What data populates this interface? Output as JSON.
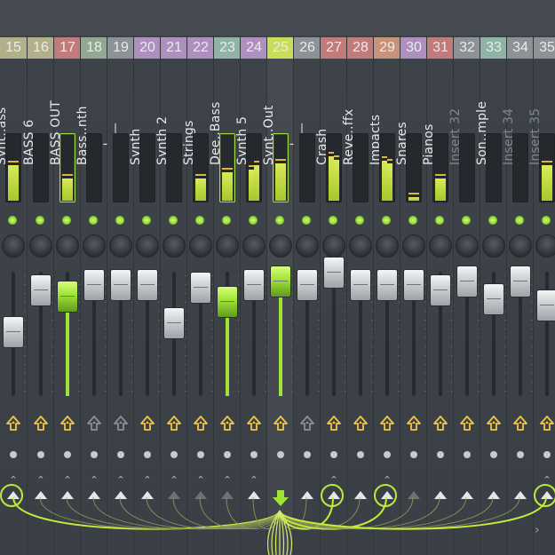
{
  "window": {
    "title": ""
  },
  "colors": {
    "accent": "#9ee336",
    "meter": "#c9e23f",
    "peak": "#e3b43a",
    "route_icon": "#f2c64a",
    "route_icon_dim": "#8a9095"
  },
  "icons": {
    "route": "route-arrow-icon",
    "send_up": "triangle-up-icon",
    "current_insert": "arrow-down-icon",
    "scroll": "chevron-right-icon"
  },
  "strips": [
    {
      "num": "15",
      "name": "Synt..ass",
      "num_bg": "#b1b08b",
      "level": 0.52,
      "meter_l": 0.55,
      "meter_r": 0.55,
      "route": "yellow",
      "caret": true,
      "send": "ring",
      "name_dim": false,
      "highlight": false
    },
    {
      "num": "16",
      "name": "BASS 6",
      "num_bg": "#b1b08b",
      "level": 0.8,
      "meter_l": 0,
      "meter_r": 0,
      "route": "yellow",
      "caret": true,
      "send": "tri",
      "name_dim": false,
      "highlight": false
    },
    {
      "num": "17",
      "name": "BASS OUT",
      "num_bg": "#c27b7b",
      "level": 0.76,
      "meter_l": 0.35,
      "meter_r": 0.35,
      "route": "yellow",
      "caret": true,
      "send": "tri",
      "name_dim": false,
      "highlight": true
    },
    {
      "num": "18",
      "name": "Bass..nth",
      "num_bg": "#93a890",
      "level": 0.84,
      "meter_l": 0,
      "meter_r": 0,
      "route": "gray",
      "caret": true,
      "send": "tri",
      "name_dim": false,
      "highlight": false
    },
    {
      "num": "19",
      "name": "___'___",
      "num_bg": "#8d9297",
      "level": 0.84,
      "meter_l": 0,
      "meter_r": 0,
      "route": "gray",
      "caret": true,
      "send": "tri",
      "name_dim": false,
      "highlight": false
    },
    {
      "num": "20",
      "name": "Synth",
      "num_bg": "#ae90bf",
      "level": 0.84,
      "meter_l": 0,
      "meter_r": 0,
      "route": "yellow",
      "caret": true,
      "send": "tri",
      "name_dim": false,
      "highlight": false
    },
    {
      "num": "21",
      "name": "Synth 2",
      "num_bg": "#ae90bf",
      "level": 0.58,
      "meter_l": 0,
      "meter_r": 0,
      "route": "yellow",
      "caret": true,
      "send": "hollow",
      "name_dim": false,
      "highlight": false
    },
    {
      "num": "22",
      "name": "Strings",
      "num_bg": "#ae90bf",
      "level": 0.82,
      "meter_l": 0.35,
      "meter_r": 0.35,
      "route": "yellow",
      "caret": true,
      "send": "hollow",
      "name_dim": false,
      "highlight": false
    },
    {
      "num": "23",
      "name": "Dee..Bass",
      "num_bg": "#8fb3a4",
      "level": 0.72,
      "meter_l": 0.45,
      "meter_r": 0.45,
      "route": "yellow",
      "caret": true,
      "send": "hollow",
      "name_dim": false,
      "highlight": true
    },
    {
      "num": "24",
      "name": "Synth 5",
      "num_bg": "#ae90bf",
      "level": 0.84,
      "meter_l": 0.48,
      "meter_r": 0.55,
      "route": "yellow",
      "caret": true,
      "send": "tri",
      "name_dim": false,
      "highlight": false
    },
    {
      "num": "25",
      "name": "Synt..Out",
      "num_bg": "#c9dd5b",
      "level": 0.86,
      "meter_l": 0.58,
      "meter_r": 0.58,
      "route": "yellow",
      "caret": false,
      "send": "down",
      "name_dim": false,
      "highlight": true
    },
    {
      "num": "26",
      "name": "___'___",
      "num_bg": "#8d9297",
      "level": 0.84,
      "meter_l": 0,
      "meter_r": 0,
      "route": "gray",
      "caret": false,
      "send": "tri",
      "name_dim": false,
      "highlight": false
    },
    {
      "num": "27",
      "name": "Crash",
      "num_bg": "#c27b7b",
      "level": 0.92,
      "meter_l": 0.7,
      "meter_r": 0.64,
      "route": "yellow",
      "caret": true,
      "send": "ring",
      "name_dim": false,
      "highlight": false
    },
    {
      "num": "28",
      "name": "Reve..ffx",
      "num_bg": "#c27b7b",
      "level": 0.84,
      "meter_l": 0,
      "meter_r": 0,
      "route": "yellow",
      "caret": false,
      "send": "tri",
      "name_dim": false,
      "highlight": false
    },
    {
      "num": "29",
      "name": "Impacts",
      "num_bg": "#c7937b",
      "level": 0.84,
      "meter_l": 0.62,
      "meter_r": 0.58,
      "route": "yellow",
      "caret": true,
      "send": "ring",
      "name_dim": false,
      "highlight": false
    },
    {
      "num": "30",
      "name": "Snares",
      "num_bg": "#ae90bf",
      "level": 0.84,
      "meter_l": 0.05,
      "meter_r": 0.05,
      "route": "yellow",
      "caret": false,
      "send": "hollow",
      "name_dim": false,
      "highlight": false
    },
    {
      "num": "31",
      "name": "Pianos",
      "num_bg": "#c27b7b",
      "level": 0.8,
      "meter_l": 0.35,
      "meter_r": 0.35,
      "route": "yellow",
      "caret": false,
      "send": "tri",
      "name_dim": false,
      "highlight": false
    },
    {
      "num": "32",
      "name": "Insert 32",
      "num_bg": "#8d9297",
      "level": 0.86,
      "meter_l": 0,
      "meter_r": 0,
      "route": "yellow",
      "caret": false,
      "send": "tri",
      "name_dim": true,
      "highlight": false
    },
    {
      "num": "33",
      "name": "Son..mple",
      "num_bg": "#8fb3a4",
      "level": 0.74,
      "meter_l": 0,
      "meter_r": 0,
      "route": "yellow",
      "caret": false,
      "send": "tri",
      "name_dim": false,
      "highlight": false
    },
    {
      "num": "34",
      "name": "Insert 34",
      "num_bg": "#8d9297",
      "level": 0.86,
      "meter_l": 0,
      "meter_r": 0,
      "route": "yellow",
      "caret": false,
      "send": "tri",
      "name_dim": true,
      "highlight": false
    },
    {
      "num": "35",
      "name": "Insert 35",
      "num_bg": "#8d9297",
      "level": 0.7,
      "meter_l": 0.55,
      "meter_r": 0.55,
      "route": "yellow",
      "caret": true,
      "send": "ring",
      "name_dim": true,
      "highlight": false
    }
  ]
}
